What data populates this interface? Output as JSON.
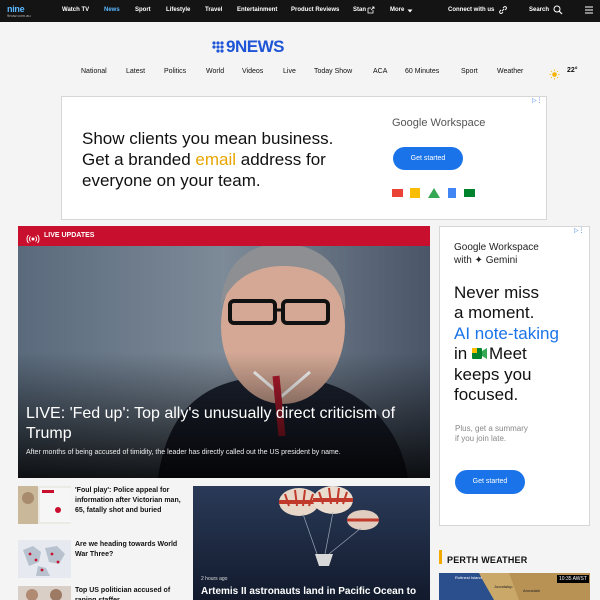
{
  "topbar": {
    "logo_big": "nine",
    "logo_small": "9now.com.au",
    "items": [
      "Watch TV",
      "News",
      "Sport",
      "Lifestyle",
      "Travel",
      "Entertainment",
      "Product Reviews",
      "Stan",
      "More"
    ],
    "connect": "Connect with us",
    "search": "Search"
  },
  "brand": {
    "name": "9NEWS"
  },
  "nav": {
    "items": [
      "National",
      "Latest",
      "Politics",
      "World",
      "Videos",
      "Live",
      "Today Show",
      "ACA",
      "60 Minutes",
      "Sport",
      "Weather"
    ],
    "temperature": "22°"
  },
  "ad_top": {
    "line1": "Show clients you mean business.",
    "line2_a": "Get a branded ",
    "line2_b": "email",
    "line2_c": " address for",
    "line3": "everyone on your team.",
    "brand": "Google Workspace",
    "cta": "Get started"
  },
  "hero": {
    "tag": "LIVE UPDATES",
    "title": "LIVE: 'Fed up': Top ally's unusually direct criticism of Trump",
    "subtitle": "After months of being accused of timidity, the leader has directly called out the US president by name."
  },
  "ad_right": {
    "brand_line1": "Google Workspace",
    "brand_line2": "with ✦ Gemini",
    "l1": "Never miss",
    "l2": "a moment.",
    "l3": "AI note-taking",
    "l4a": "in ",
    "l4b": "Meet",
    "l5": "keeps you",
    "l6": "focused.",
    "small1": "Plus, get a summary",
    "small2": "if you join late.",
    "cta": "Get started"
  },
  "stories": [
    {
      "title": "'Foul play': Police appeal for information after Victorian man, 65, fatally shot and buried"
    },
    {
      "title": "Are we heading towards World War Three?"
    },
    {
      "title": "Top US politician accused of raping staffer"
    }
  ],
  "midcard": {
    "time": "2 hours ago",
    "headline": "Artemis II astronauts land in Pacific Ocean to"
  },
  "weather": {
    "label": "PERTH WEATHER",
    "time": "10:35 AWST",
    "town1": "Rottnest Island",
    "town2": "Joondalup",
    "town3": "Armadale"
  },
  "colors": {
    "topbar": "#141414",
    "accent": "#5bb8ff",
    "brand": "#1e54d6",
    "live": "#c8102e",
    "google_blue": "#1a73e8"
  }
}
